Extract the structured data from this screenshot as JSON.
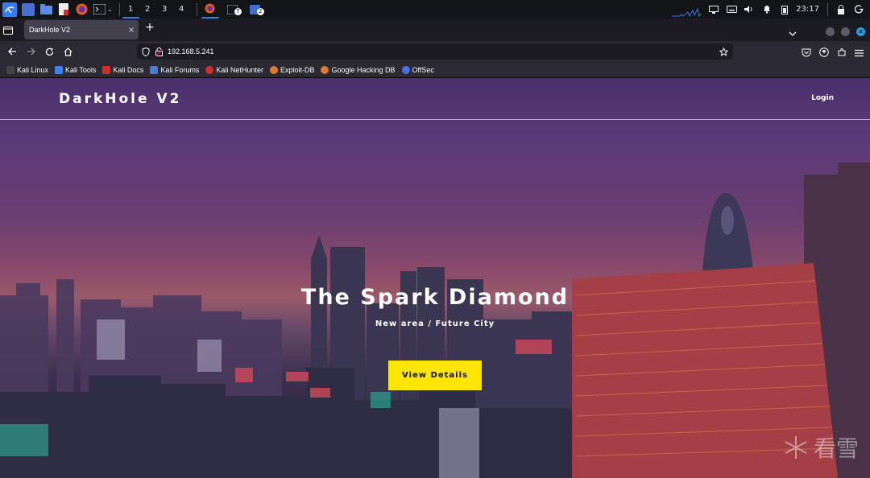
{
  "taskbar": {
    "workspaces": [
      "1",
      "2",
      "3",
      "4"
    ],
    "active_workspace": "1",
    "badge_one": "7",
    "badge_two": "2",
    "clock": "23:17",
    "accent": "#367bf0"
  },
  "browser": {
    "tab": {
      "title": "DarkHole V2",
      "close": "×"
    },
    "new_tab": "+",
    "url": "192.168.5.241",
    "bookmarks": [
      {
        "label": "Kali Linux",
        "color": "#1e1e1e"
      },
      {
        "label": "Kali Tools",
        "color": "#3b82f6"
      },
      {
        "label": "Kali Docs",
        "color": "#d22d2d"
      },
      {
        "label": "Kali Forums",
        "color": "#4a7bd0"
      },
      {
        "label": "Kali NetHunter",
        "color": "#d22d2d"
      },
      {
        "label": "Exploit-DB",
        "color": "#e07b2a"
      },
      {
        "label": "Google Hacking DB",
        "color": "#e07b2a"
      },
      {
        "label": "OffSec",
        "color": "#4a6fe0"
      }
    ]
  },
  "site": {
    "brand": "DarkHole V2",
    "nav": {
      "login": "Login"
    },
    "hero": {
      "title": "The Spark Diamond",
      "subtitle": "New area / Future City",
      "cta": "View Details",
      "cta_color": "#ffe600"
    },
    "watermark": "看雪"
  }
}
